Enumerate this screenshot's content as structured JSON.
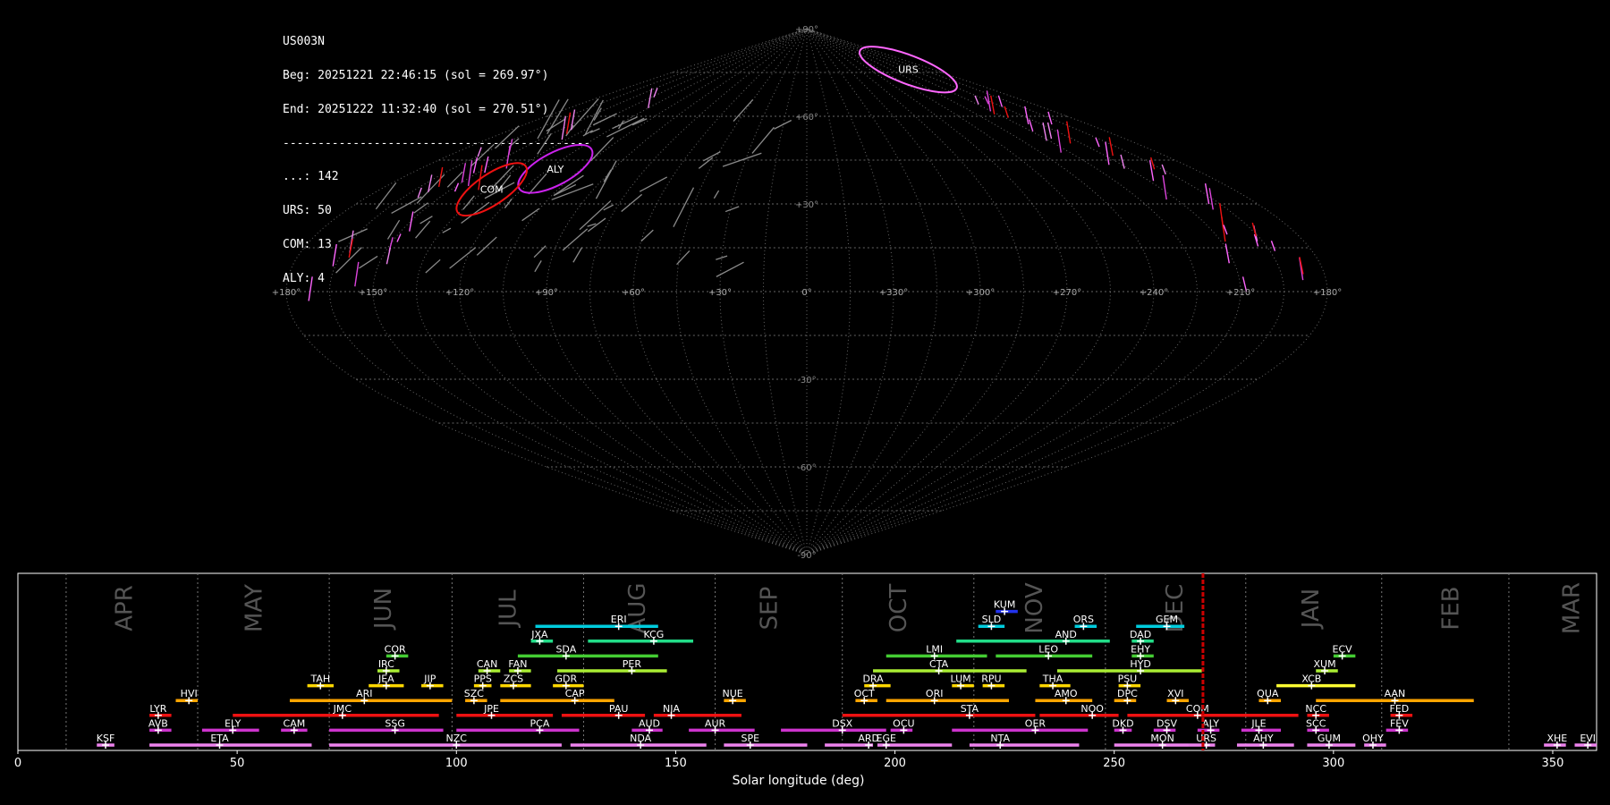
{
  "info": {
    "station": "US003N",
    "begin": "Beg: 20251221 22:46:15 (sol = 269.97°)",
    "end": "End: 20251222 11:32:40 (sol = 270.51°)",
    "separator": "--------------------------------------------",
    "counts": [
      "...: 142",
      "URS: 50",
      "COM: 13",
      "ALY: 4"
    ]
  },
  "colors": {
    "background": "#000000",
    "grid": "#666666",
    "current_sol": "#cc0000",
    "sporadic_meteor": "#8a8a8a"
  },
  "chart_data": [
    {
      "type": "scatter",
      "projection": "sinusoidal sky map",
      "title": "",
      "lon_tick_labels": [
        "+180°",
        "+150°",
        "+120°",
        "+90°",
        "+60°",
        "+30°",
        "0°",
        "+330°",
        "+300°",
        "+270°",
        "+240°",
        "+210°",
        "+180°"
      ],
      "lat_tick_labels": [
        "+90°",
        "+60°",
        "+30°",
        "-30°",
        "-60°",
        "-90°"
      ],
      "lon_tick_values": [
        180,
        150,
        120,
        90,
        60,
        30,
        0,
        330,
        300,
        270,
        240,
        210,
        180
      ],
      "lat_tick_values": [
        90,
        60,
        30,
        -30,
        -60,
        -90
      ],
      "radiants": [
        {
          "label": "URS",
          "lon": 215,
          "lat": 76,
          "rx": 58,
          "ry": 16,
          "tilt": 21,
          "color": "#ff66ff"
        },
        {
          "label": "ALY",
          "lon": 117,
          "lat": 42,
          "rx": 46,
          "ry": 18,
          "tilt": -28,
          "color": "#cc22ee"
        },
        {
          "label": "COM",
          "lon": 133,
          "lat": 35,
          "rx": 46,
          "ry": 17,
          "tilt": -34,
          "color": "#ee1111"
        }
      ]
    },
    {
      "type": "bar",
      "xlabel": "Solar longitude (deg)",
      "xlim": [
        0,
        360
      ],
      "x_ticks": [
        0,
        50,
        100,
        150,
        200,
        250,
        300,
        350
      ],
      "current_sol": 270.24,
      "months": [
        {
          "name": "APR",
          "at": 24.5
        },
        {
          "name": "MAY",
          "at": 54
        },
        {
          "name": "JUN",
          "at": 83.5
        },
        {
          "name": "JUL",
          "at": 112
        },
        {
          "name": "AUG",
          "at": 141.5
        },
        {
          "name": "SEP",
          "at": 171.5
        },
        {
          "name": "OCT",
          "at": 201
        },
        {
          "name": "NOV",
          "at": 232
        },
        {
          "name": "DEC",
          "at": 264
        },
        {
          "name": "JAN",
          "at": 295
        },
        {
          "name": "FEB",
          "at": 327
        },
        {
          "name": "MAR",
          "at": 354.5
        }
      ],
      "month_boundaries": [
        11,
        41,
        71,
        99,
        129,
        159,
        188,
        218,
        248,
        280,
        311,
        340
      ],
      "showers": [
        {
          "code": "KSF",
          "start": 18,
          "end": 22,
          "peak": 20,
          "row": 0,
          "color": "#ee82ee"
        },
        {
          "code": "ETA",
          "start": 30,
          "end": 67,
          "peak": 46,
          "row": 0,
          "color": "#ee82ee"
        },
        {
          "code": "NZC",
          "start": 71,
          "end": 124,
          "peak": 100,
          "row": 0,
          "color": "#ee82ee"
        },
        {
          "code": "NDA",
          "start": 126,
          "end": 157,
          "peak": 142,
          "row": 0,
          "color": "#ee82ee"
        },
        {
          "code": "SPE",
          "start": 161,
          "end": 180,
          "peak": 167,
          "row": 0,
          "color": "#ee82ee"
        },
        {
          "code": "ARD",
          "start": 184,
          "end": 195,
          "peak": 194,
          "row": 0,
          "color": "#ee82ee"
        },
        {
          "code": "EGE",
          "start": 196,
          "end": 213,
          "peak": 198,
          "row": 0,
          "color": "#ee82ee"
        },
        {
          "code": "NTA",
          "start": 217,
          "end": 242,
          "peak": 224,
          "row": 0,
          "color": "#ee82ee"
        },
        {
          "code": "MON",
          "start": 250,
          "end": 267,
          "peak": 261,
          "row": 0,
          "color": "#ee82ee"
        },
        {
          "code": "URS",
          "start": 267,
          "end": 273,
          "peak": 271,
          "row": 0,
          "color": "#ee82ee"
        },
        {
          "code": "AHY",
          "start": 278,
          "end": 291,
          "peak": 284,
          "row": 0,
          "color": "#ee82ee"
        },
        {
          "code": "GUM",
          "start": 294,
          "end": 305,
          "peak": 299,
          "row": 0,
          "color": "#ee82ee"
        },
        {
          "code": "OHY",
          "start": 307,
          "end": 312,
          "peak": 309,
          "row": 0,
          "color": "#ee82ee"
        },
        {
          "code": "XHE",
          "start": 348,
          "end": 353,
          "peak": 351,
          "row": 0,
          "color": "#ee82ee"
        },
        {
          "code": "EVI",
          "start": 355,
          "end": 360,
          "peak": 358,
          "row": 0,
          "color": "#ee82ee"
        },
        {
          "code": "AVB",
          "start": 30,
          "end": 35,
          "peak": 32,
          "row": 1,
          "color": "#cc33cc"
        },
        {
          "code": "ELY",
          "start": 42,
          "end": 55,
          "peak": 49,
          "row": 1,
          "color": "#cc33cc"
        },
        {
          "code": "CAM",
          "start": 60,
          "end": 66,
          "peak": 63,
          "row": 1,
          "color": "#cc33cc"
        },
        {
          "code": "SSG",
          "start": 71,
          "end": 97,
          "peak": 86,
          "row": 1,
          "color": "#cc33cc"
        },
        {
          "code": "PCA",
          "start": 100,
          "end": 128,
          "peak": 119,
          "row": 1,
          "color": "#cc33cc"
        },
        {
          "code": "AUD",
          "start": 140,
          "end": 147,
          "peak": 144,
          "row": 1,
          "color": "#cc33cc"
        },
        {
          "code": "AUR",
          "start": 153,
          "end": 168,
          "peak": 159,
          "row": 1,
          "color": "#cc33cc"
        },
        {
          "code": "DSX",
          "start": 174,
          "end": 198,
          "peak": 188,
          "row": 1,
          "color": "#cc33cc"
        },
        {
          "code": "OCU",
          "start": 199,
          "end": 204,
          "peak": 202,
          "row": 1,
          "color": "#cc33cc"
        },
        {
          "code": "OER",
          "start": 213,
          "end": 244,
          "peak": 232,
          "row": 1,
          "color": "#cc33cc"
        },
        {
          "code": "DKD",
          "start": 250,
          "end": 254,
          "peak": 252,
          "row": 1,
          "color": "#cc33cc"
        },
        {
          "code": "DSV",
          "start": 259,
          "end": 264,
          "peak": 262,
          "row": 1,
          "color": "#cc33cc"
        },
        {
          "code": "ALY",
          "start": 269,
          "end": 274,
          "peak": 272,
          "row": 1,
          "color": "#cc33cc"
        },
        {
          "code": "JLE",
          "start": 279,
          "end": 288,
          "peak": 283,
          "row": 1,
          "color": "#cc33cc"
        },
        {
          "code": "SCC",
          "start": 294,
          "end": 299,
          "peak": 296,
          "row": 1,
          "color": "#cc33cc"
        },
        {
          "code": "FEV",
          "start": 312,
          "end": 317,
          "peak": 315,
          "row": 1,
          "color": "#cc33cc"
        },
        {
          "code": "LYR",
          "start": 30,
          "end": 35,
          "peak": 32,
          "row": 2,
          "color": "#ee1111"
        },
        {
          "code": "JMC",
          "start": 49,
          "end": 96,
          "peak": 74,
          "row": 2,
          "color": "#ee1111"
        },
        {
          "code": "JPE",
          "start": 100,
          "end": 122,
          "peak": 108,
          "row": 2,
          "color": "#ee1111"
        },
        {
          "code": "PAU",
          "start": 124,
          "end": 143,
          "peak": 137,
          "row": 2,
          "color": "#ee1111"
        },
        {
          "code": "NIA",
          "start": 145,
          "end": 165,
          "peak": 149,
          "row": 2,
          "color": "#ee1111"
        },
        {
          "code": "STA",
          "start": 188,
          "end": 232,
          "peak": 217,
          "row": 2,
          "color": "#ee1111"
        },
        {
          "code": "NOO",
          "start": 233,
          "end": 251,
          "peak": 245,
          "row": 2,
          "color": "#ee1111"
        },
        {
          "code": "COM",
          "start": 253,
          "end": 292,
          "peak": 269,
          "row": 2,
          "color": "#ee1111"
        },
        {
          "code": "NCC",
          "start": 294,
          "end": 299,
          "peak": 296,
          "row": 2,
          "color": "#ee1111"
        },
        {
          "code": "FED",
          "start": 313,
          "end": 318,
          "peak": 315,
          "row": 2,
          "color": "#ee1111"
        },
        {
          "code": "HVI",
          "start": 36,
          "end": 41,
          "peak": 39,
          "row": 3,
          "color": "#ffa500"
        },
        {
          "code": "ARI",
          "start": 62,
          "end": 99,
          "peak": 79,
          "row": 3,
          "color": "#ffa500"
        },
        {
          "code": "SZC",
          "start": 102,
          "end": 107,
          "peak": 104,
          "row": 3,
          "color": "#ffa500"
        },
        {
          "code": "CAP",
          "start": 110,
          "end": 136,
          "peak": 127,
          "row": 3,
          "color": "#ffa500"
        },
        {
          "code": "NUE",
          "start": 161,
          "end": 166,
          "peak": 163,
          "row": 3,
          "color": "#ffa500"
        },
        {
          "code": "OCT",
          "start": 191,
          "end": 196,
          "peak": 193,
          "row": 3,
          "color": "#ffa500"
        },
        {
          "code": "ORI",
          "start": 198,
          "end": 226,
          "peak": 209,
          "row": 3,
          "color": "#ffa500"
        },
        {
          "code": "AMO",
          "start": 232,
          "end": 245,
          "peak": 239,
          "row": 3,
          "color": "#ffa500"
        },
        {
          "code": "DPC",
          "start": 250,
          "end": 255,
          "peak": 253,
          "row": 3,
          "color": "#ffa500"
        },
        {
          "code": "XVI",
          "start": 262,
          "end": 267,
          "peak": 264,
          "row": 3,
          "color": "#ffa500"
        },
        {
          "code": "QUA",
          "start": 283,
          "end": 288,
          "peak": 285,
          "row": 3,
          "color": "#ffa500"
        },
        {
          "code": "AAN",
          "start": 296,
          "end": 332,
          "peak": 314,
          "row": 3,
          "color": "#ffa500"
        },
        {
          "code": "TAH",
          "start": 66,
          "end": 72,
          "peak": 69,
          "row": 4,
          "color": "#ffd700"
        },
        {
          "code": "JEA",
          "start": 80,
          "end": 88,
          "peak": 84,
          "row": 4,
          "color": "#ffd700"
        },
        {
          "code": "JIP",
          "start": 92,
          "end": 97,
          "peak": 94,
          "row": 4,
          "color": "#ffd700"
        },
        {
          "code": "PPS",
          "start": 104,
          "end": 108,
          "peak": 106,
          "row": 4,
          "color": "#ffd700"
        },
        {
          "code": "ZCS",
          "start": 110,
          "end": 117,
          "peak": 113,
          "row": 4,
          "color": "#ffd700"
        },
        {
          "code": "GDR",
          "start": 122,
          "end": 129,
          "peak": 125,
          "row": 4,
          "color": "#ffd700"
        },
        {
          "code": "DRA",
          "start": 193,
          "end": 199,
          "peak": 195,
          "row": 4,
          "color": "#ffd700"
        },
        {
          "code": "LUM",
          "start": 213,
          "end": 218,
          "peak": 215,
          "row": 4,
          "color": "#ffd700"
        },
        {
          "code": "RPU",
          "start": 220,
          "end": 225,
          "peak": 222,
          "row": 4,
          "color": "#ffd700"
        },
        {
          "code": "THA",
          "start": 233,
          "end": 240,
          "peak": 236,
          "row": 4,
          "color": "#ffd700"
        },
        {
          "code": "PSU",
          "start": 251,
          "end": 256,
          "peak": 253,
          "row": 4,
          "color": "#ffd700"
        },
        {
          "code": "XCB",
          "start": 287,
          "end": 305,
          "peak": 295,
          "row": 4,
          "color": "#ffff33"
        },
        {
          "code": "IRC",
          "start": 82,
          "end": 87,
          "peak": 84,
          "row": 5,
          "color": "#aaee33"
        },
        {
          "code": "CAN",
          "start": 105,
          "end": 110,
          "peak": 107,
          "row": 5,
          "color": "#aaee33"
        },
        {
          "code": "FAN",
          "start": 112,
          "end": 117,
          "peak": 114,
          "row": 5,
          "color": "#aaee33"
        },
        {
          "code": "PER",
          "start": 123,
          "end": 148,
          "peak": 140,
          "row": 5,
          "color": "#aaee33"
        },
        {
          "code": "CTA",
          "start": 195,
          "end": 230,
          "peak": 210,
          "row": 5,
          "color": "#aaee33"
        },
        {
          "code": "HYD",
          "start": 237,
          "end": 270,
          "peak": 256,
          "row": 5,
          "color": "#aaee33"
        },
        {
          "code": "XUM",
          "start": 296,
          "end": 301,
          "peak": 298,
          "row": 5,
          "color": "#aaee33"
        },
        {
          "code": "COR",
          "start": 84,
          "end": 89,
          "peak": 86,
          "row": 6,
          "color": "#44cc33"
        },
        {
          "code": "SDA",
          "start": 114,
          "end": 146,
          "peak": 125,
          "row": 6,
          "color": "#44cc33"
        },
        {
          "code": "LMI",
          "start": 198,
          "end": 221,
          "peak": 209,
          "row": 6,
          "color": "#44cc33"
        },
        {
          "code": "LEO",
          "start": 223,
          "end": 245,
          "peak": 235,
          "row": 6,
          "color": "#44cc33"
        },
        {
          "code": "EHY",
          "start": 254,
          "end": 259,
          "peak": 256,
          "row": 6,
          "color": "#44cc33"
        },
        {
          "code": "ECV",
          "start": 300,
          "end": 305,
          "peak": 302,
          "row": 6,
          "color": "#44cc33"
        },
        {
          "code": "JXA",
          "start": 117,
          "end": 122,
          "peak": 119,
          "row": 7,
          "color": "#22dd88"
        },
        {
          "code": "KCG",
          "start": 130,
          "end": 154,
          "peak": 145,
          "row": 7,
          "color": "#22dd88"
        },
        {
          "code": "AND",
          "start": 214,
          "end": 249,
          "peak": 239,
          "row": 7,
          "color": "#22dd88"
        },
        {
          "code": "DAD",
          "start": 254,
          "end": 259,
          "peak": 256,
          "row": 7,
          "color": "#22dd88"
        },
        {
          "code": "ERI",
          "start": 118,
          "end": 146,
          "peak": 137,
          "row": 8,
          "color": "#00ccdd"
        },
        {
          "code": "SLD",
          "start": 219,
          "end": 225,
          "peak": 222,
          "row": 8,
          "color": "#00ccdd"
        },
        {
          "code": "ORS",
          "start": 241,
          "end": 246,
          "peak": 243,
          "row": 8,
          "color": "#00ccdd"
        },
        {
          "code": "GEM",
          "start": 255,
          "end": 266,
          "peak": 262,
          "row": 8,
          "color": "#00ccdd"
        },
        {
          "code": "KUM",
          "start": 223,
          "end": 228,
          "peak": 225,
          "row": 9,
          "color": "#2233ee"
        }
      ]
    }
  ]
}
